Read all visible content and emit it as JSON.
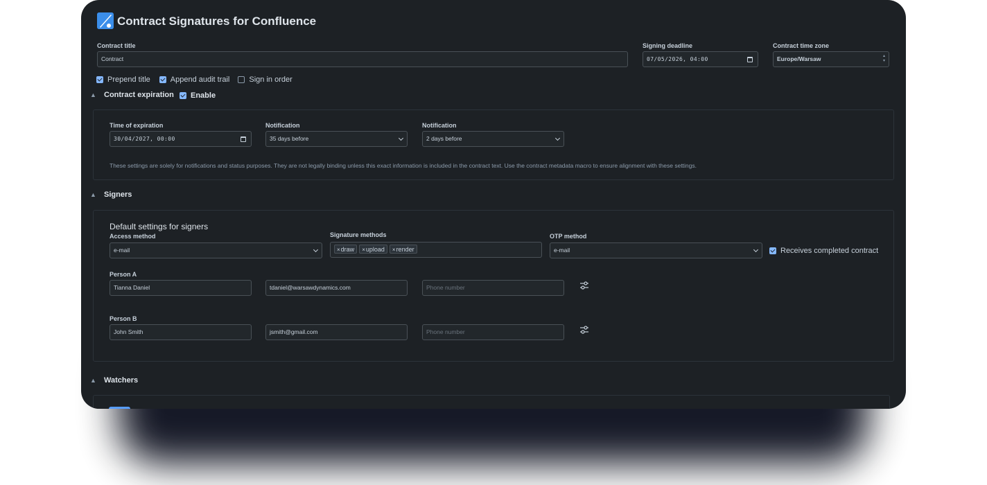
{
  "app": {
    "title": "Contract Signatures for Confluence",
    "logo_icon": "pen-logo-icon",
    "accent": "#85b8ff"
  },
  "contract": {
    "title_label": "Contract title",
    "title_value": "Contract",
    "deadline_label": "Signing deadline",
    "deadline_value": "07/05/2026, 04:00",
    "timezone_label": "Contract time zone",
    "timezone_value": "Europe/Warsaw",
    "options": [
      {
        "label": "Prepend title",
        "checked": true
      },
      {
        "label": "Append audit trail",
        "checked": true
      },
      {
        "label": "Sign in order",
        "checked": false
      }
    ]
  },
  "expiration": {
    "section_label": "Contract expiration",
    "enable_label": "Enable",
    "enabled": true,
    "time_label": "Time of expiration",
    "time_value": "30/04/2027, 00:00",
    "notification1_label": "Notification",
    "notification1_value": "35 days before",
    "notification2_label": "Notification",
    "notification2_value": "2 days before",
    "note": "These settings are solely for notifications and status purposes. They are not legally binding unless this exact information is included in the contract text. Use the contract metadata macro to ensure alignment with these settings."
  },
  "signers": {
    "section_label": "Signers",
    "defaults_title": "Default settings for signers",
    "access_label": "Access method",
    "access_value": "e-mail",
    "methods_label": "Signature methods",
    "methods": [
      "draw",
      "upload",
      "render"
    ],
    "otp_label": "OTP method",
    "otp_value": "e-mail",
    "receives_label": "Receives completed contract",
    "receives_checked": true,
    "people": [
      {
        "label": "Person A",
        "name": "Tianna Daniel",
        "email": "tdaniel@warsawdynamics.com",
        "phone_placeholder": "Phone number"
      },
      {
        "label": "Person B",
        "name": "John Smith",
        "email": "jsmith@gmail.com",
        "phone_placeholder": "Phone number"
      }
    ]
  },
  "watchers": {
    "section_label": "Watchers"
  }
}
